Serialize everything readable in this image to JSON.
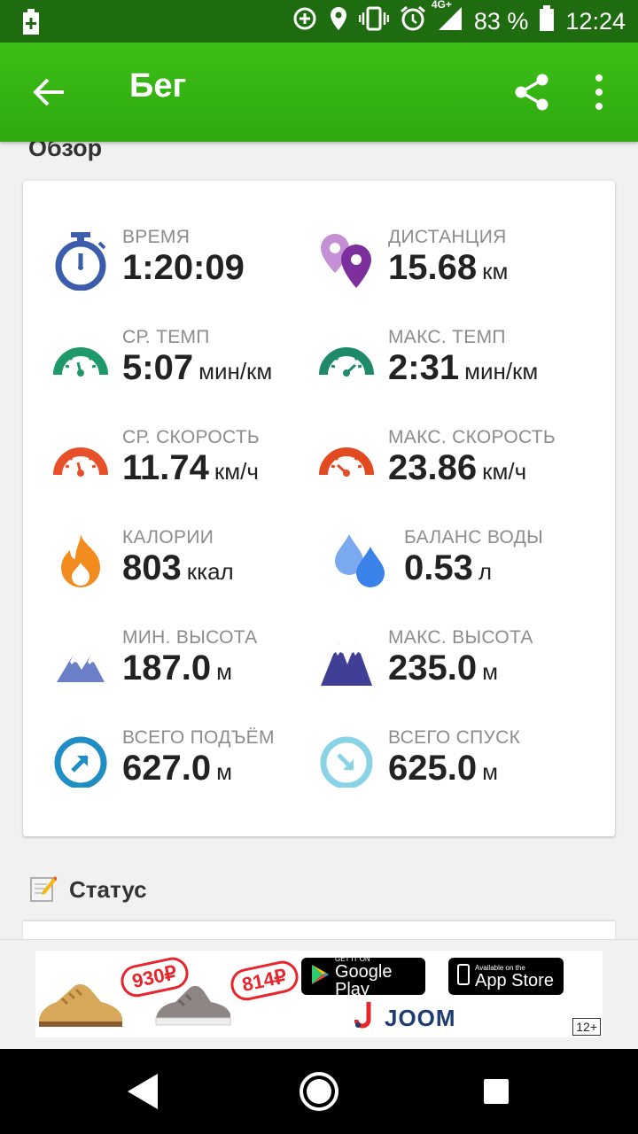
{
  "status_bar": {
    "network": "4G+",
    "battery": "83 %",
    "time": "12:24"
  },
  "app_bar": {
    "title": "Бег"
  },
  "overview": {
    "section_title": "Обзор",
    "stats": [
      {
        "label": "ВРЕМЯ",
        "value": "1:20:09",
        "unit": "",
        "icon": "stopwatch-icon",
        "color": "#3b5dab"
      },
      {
        "label": "ДИСТАНЦИЯ",
        "value": "15.68",
        "unit": "км",
        "icon": "map-pins-icon",
        "color": "#8e44ad"
      },
      {
        "label": "СР. ТЕМП",
        "value": "5:07",
        "unit": "мин/км",
        "icon": "speedometer-icon",
        "color": "#1e9a6a"
      },
      {
        "label": "МАКС. ТЕМП",
        "value": "2:31",
        "unit": "мин/км",
        "icon": "speedometer-icon",
        "color": "#1e8a6a"
      },
      {
        "label": "СР. СКОРОСТЬ",
        "value": "11.74",
        "unit": "км/ч",
        "icon": "speedometer-icon",
        "color": "#e8502a"
      },
      {
        "label": "МАКС. СКОРОСТЬ",
        "value": "23.86",
        "unit": "км/ч",
        "icon": "speedometer-icon",
        "color": "#e24a22"
      },
      {
        "label": "КАЛОРИИ",
        "value": "803",
        "unit": "ккал",
        "icon": "fire-icon",
        "color": "#f28c1e"
      },
      {
        "label": "БАЛАНС ВОДЫ",
        "value": "0.53",
        "unit": "л",
        "icon": "water-drops-icon",
        "color": "#3b82e8"
      },
      {
        "label": "МИН. ВЫСОТА",
        "value": "187.0",
        "unit": "м",
        "icon": "mountains-icon",
        "color": "#6b7fc8"
      },
      {
        "label": "МАКС. ВЫСОТА",
        "value": "235.0",
        "unit": "м",
        "icon": "mountains-icon",
        "color": "#3e3f95"
      },
      {
        "label": "ВСЕГО ПОДЪЁМ",
        "value": "627.0",
        "unit": "м",
        "icon": "arrow-up-circle-icon",
        "color": "#1f8ec4"
      },
      {
        "label": "ВСЕГО СПУСК",
        "value": "625.0",
        "unit": "м",
        "icon": "arrow-down-circle-icon",
        "color": "#8ad3e6"
      }
    ]
  },
  "status_section": {
    "title": "Статус"
  },
  "ad": {
    "price_1": "930₽",
    "price_2": "814₽",
    "google_small": "GET IT ON",
    "google_big": "Google Play",
    "apple_small": "Available on the",
    "apple_big": "App Store",
    "brand": "JOOM",
    "age_rating": "12+"
  }
}
